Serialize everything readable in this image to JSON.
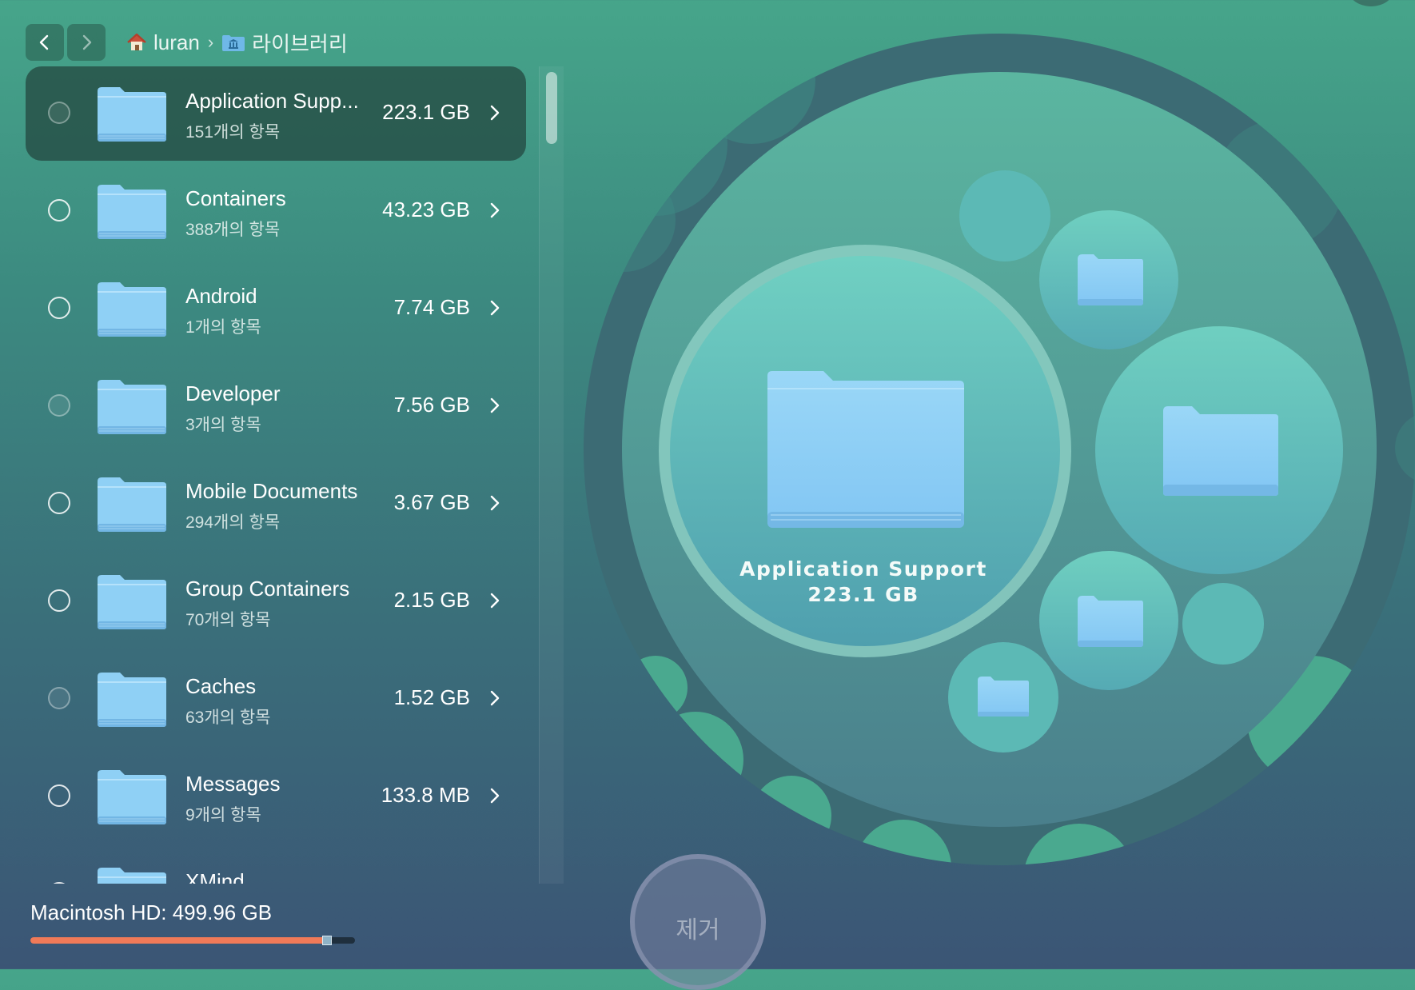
{
  "navigation": {
    "back_icon": "chevron-left-icon",
    "forward_icon": "chevron-right-icon",
    "breadcrumb": [
      {
        "icon": "home-icon",
        "label": "luran"
      },
      {
        "icon": "library-folder-icon",
        "label": "라이브러리"
      }
    ],
    "separator": "›"
  },
  "folders": [
    {
      "name": "Application Supp...",
      "items": "151개의 항목",
      "size": "223.1 GB",
      "selected": true
    },
    {
      "name": "Containers",
      "items": "388개의 항목",
      "size": "43.23 GB",
      "selected": false
    },
    {
      "name": "Android",
      "items": "1개의 항목",
      "size": "7.74 GB",
      "selected": false
    },
    {
      "name": "Developer",
      "items": "3개의 항목",
      "size": "7.56 GB",
      "selected": false
    },
    {
      "name": "Mobile Documents",
      "items": "294개의 항목",
      "size": "3.67 GB",
      "selected": false
    },
    {
      "name": "Group Containers",
      "items": "70개의 항목",
      "size": "2.15 GB",
      "selected": false
    },
    {
      "name": "Caches",
      "items": "63개의 항목",
      "size": "1.52 GB",
      "selected": false
    },
    {
      "name": "Messages",
      "items": "9개의 항목",
      "size": "133.8 MB",
      "selected": false
    },
    {
      "name": "XMind",
      "items": "",
      "size": "",
      "selected": false
    }
  ],
  "disk": {
    "label": "Macintosh HD: 499.96 GB",
    "used_fraction": 0.91
  },
  "visualization": {
    "center_name": "Application Support",
    "center_size": "223.1 GB"
  },
  "remove_button": {
    "label": "제거"
  },
  "colors": {
    "selected_row": "#264e46",
    "disk_fill": "#f07a58",
    "folder_blue": "#8fd0f5"
  }
}
